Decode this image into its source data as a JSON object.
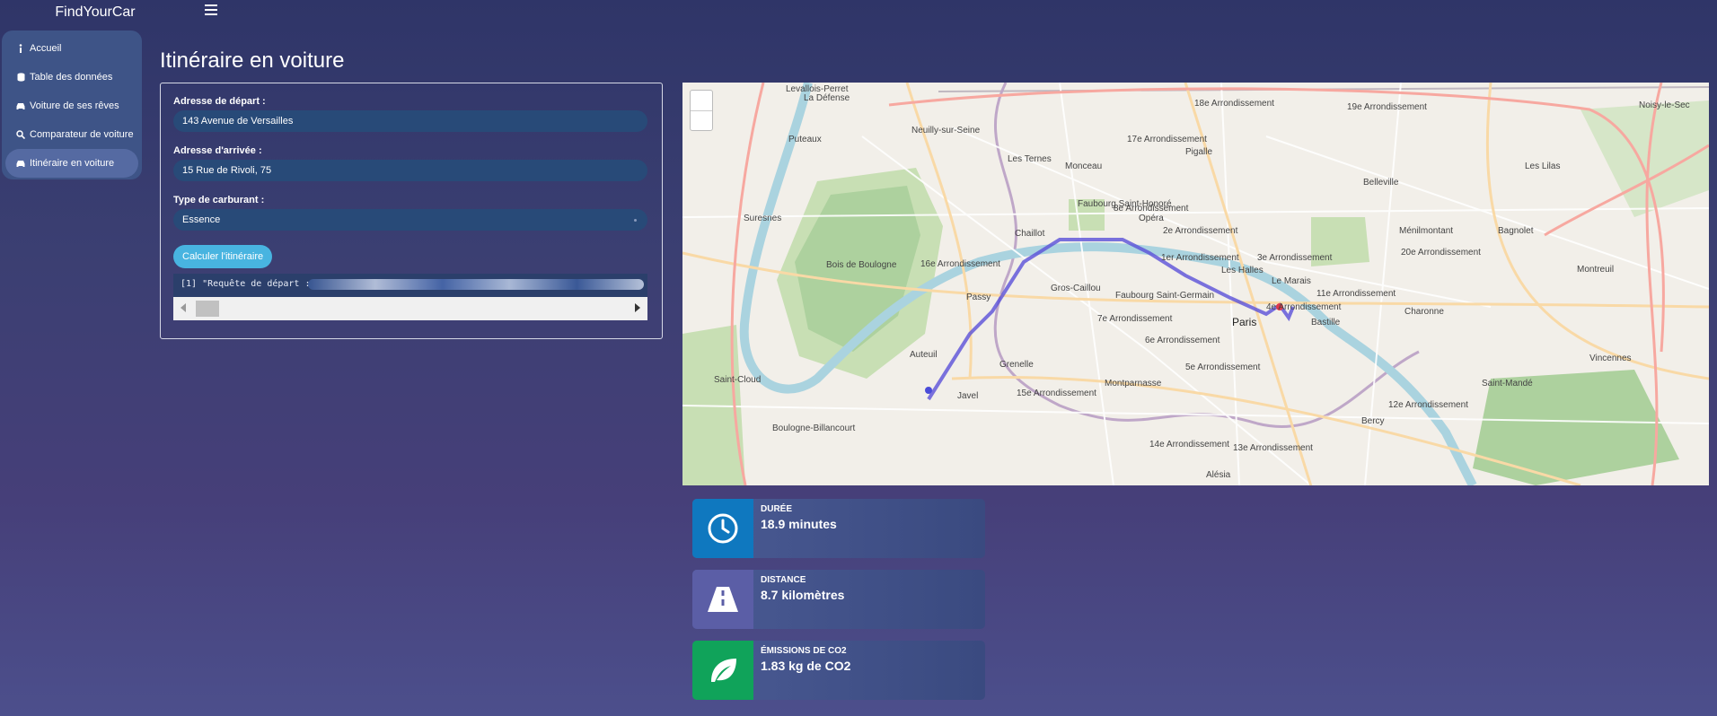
{
  "brand": "FindYourCar",
  "sidebar": {
    "items": [
      {
        "label": "Accueil",
        "icon": "info-icon"
      },
      {
        "label": "Table des données",
        "icon": "database-icon"
      },
      {
        "label": "Voiture de ses rêves",
        "icon": "car-icon"
      },
      {
        "label": "Comparateur de voiture",
        "icon": "search-icon"
      },
      {
        "label": "Itinéraire en voiture",
        "icon": "car-icon",
        "active": true
      }
    ]
  },
  "page": {
    "title": "Itinéraire en voiture"
  },
  "form": {
    "start_label": "Adresse de départ :",
    "start_value": "143 Avenue de Versailles",
    "end_label": "Adresse d'arrivée :",
    "end_value": "15 Rue de Rivoli, 75",
    "fuel_label": "Type de carburant :",
    "fuel_value": "Essence",
    "calc_button": "Calculer l'itinéraire",
    "console_text": "[1] \"Requête de départ :"
  },
  "map": {
    "labels": {
      "levallois": "Levallois-Perret",
      "defense": "La Défense",
      "neuilly": "Neuilly-sur-Seine",
      "puteaux": "Puteaux",
      "suresnes": "Suresnes",
      "boulogne_bois": "Bois de Boulogne",
      "arr16": "16e Arrondissement",
      "passy": "Passy",
      "auteuil": "Auteuil",
      "stcloud": "Saint-Cloud",
      "boulogne_bill": "Boulogne-Billancourt",
      "javel": "Javel",
      "grenelle": "Grenelle",
      "arr15": "15e Arrondissement",
      "grosc": "Gros-Caillou",
      "chaillot": "Chaillot",
      "monceau": "Monceau",
      "ternes": "Les Ternes",
      "arr17": "17e Arrondissement",
      "arr8": "8e Arrondissement",
      "fsh": "Faubourg Saint-Honoré",
      "fsg": "Faubourg Saint-Germain",
      "arr7": "7e Arrondissement",
      "arr6": "6e Arrondissement",
      "arr5": "5e Arrondissement",
      "arr14": "14e Arrondissement",
      "arr13": "13e Arrondissement",
      "arr1": "1er Arrondissement",
      "arr2": "2e Arrondissement",
      "arr3": "3e Arrondissement",
      "arr4": "4e Arrondissement",
      "paris": "Paris",
      "marais": "Le Marais",
      "halles": "Les Halles",
      "opera": "Opéra",
      "pigalle": "Pigalle",
      "arr18": "18e Arrondissement",
      "arr19": "19e Arrondissement",
      "arr20": "20e Arrondissement",
      "arr11": "11e Arrondissement",
      "arr12": "12e Arrondissement",
      "montparnasse": "Montparnasse",
      "bastille": "Bastille",
      "belleville": "Belleville",
      "menilmontant": "Ménilmontant",
      "bagnolet": "Bagnolet",
      "montreuil": "Montreuil",
      "vincennes": "Vincennes",
      "stmande": "Saint-Mandé",
      "charonne": "Charonne",
      "lilas": "Les Lilas",
      "noisy": "Noisy-le-Sec",
      "alesia": "Alésia",
      "bercy": "Bercy"
    }
  },
  "stats": [
    {
      "label": "DURÉE",
      "value": "18.9 minutes",
      "icon": "clock-icon",
      "color": "#0f78bf"
    },
    {
      "label": "DISTANCE",
      "value": "8.7 kilomètres",
      "icon": "road-icon",
      "color": "#5b5ea6"
    },
    {
      "label": "ÉMISSIONS DE CO2",
      "value": "1.83 kg de CO2",
      "icon": "leaf-icon",
      "color": "#10a35a"
    }
  ]
}
